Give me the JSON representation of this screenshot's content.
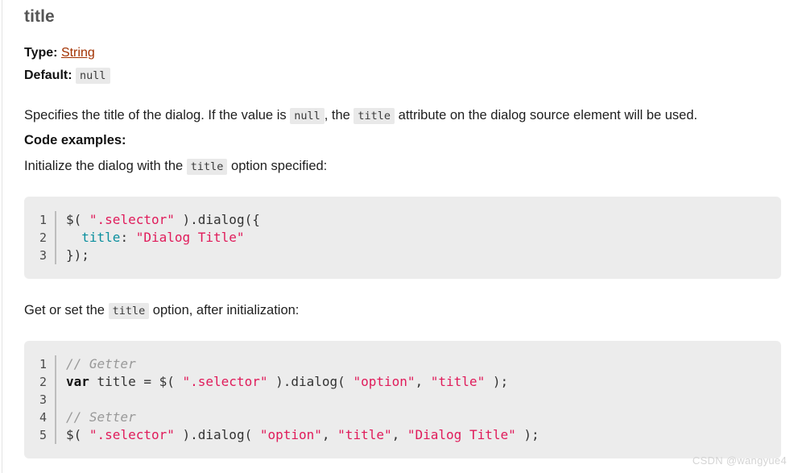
{
  "page": {
    "entry_title": "title"
  },
  "meta": {
    "type_label": "Type:",
    "type_value": "String",
    "default_label": "Default:",
    "default_value": "null"
  },
  "description": {
    "part1": "Specifies the title of the dialog. If the value is ",
    "code1": "null",
    "part2": ", the ",
    "code2": "title",
    "part3": " attribute on the dialog source element will be used."
  },
  "code_examples_heading": "Code examples:",
  "init_caption": {
    "part1": "Initialize the dialog with the ",
    "code1": "title",
    "part2": " option specified:"
  },
  "getset_caption": {
    "part1": "Get or set the ",
    "code1": "title",
    "part2": " option, after initialization:"
  },
  "code_block_1": {
    "lines": [
      {
        "no": "1",
        "tokens": [
          {
            "t": "$( ",
            "c": "pun"
          },
          {
            "t": "\".selector\"",
            "c": "str"
          },
          {
            "t": " ).dialog({",
            "c": "pun"
          }
        ]
      },
      {
        "no": "2",
        "tokens": [
          {
            "t": "  ",
            "c": "pun"
          },
          {
            "t": "title",
            "c": "key"
          },
          {
            "t": ": ",
            "c": "pun"
          },
          {
            "t": "\"Dialog Title\"",
            "c": "str"
          }
        ]
      },
      {
        "no": "3",
        "tokens": [
          {
            "t": "});",
            "c": "pun"
          }
        ]
      }
    ]
  },
  "code_block_2": {
    "lines": [
      {
        "no": "1",
        "tokens": [
          {
            "t": "// Getter",
            "c": "com"
          }
        ]
      },
      {
        "no": "2",
        "tokens": [
          {
            "t": "var",
            "c": "var"
          },
          {
            "t": " title = $( ",
            "c": "pun"
          },
          {
            "t": "\".selector\"",
            "c": "str"
          },
          {
            "t": " ).dialog( ",
            "c": "pun"
          },
          {
            "t": "\"option\"",
            "c": "str"
          },
          {
            "t": ", ",
            "c": "pun"
          },
          {
            "t": "\"title\"",
            "c": "str"
          },
          {
            "t": " );",
            "c": "pun"
          }
        ]
      },
      {
        "no": "3",
        "tokens": [
          {
            "t": "",
            "c": "pun"
          }
        ]
      },
      {
        "no": "4",
        "tokens": [
          {
            "t": "// Setter",
            "c": "com"
          }
        ]
      },
      {
        "no": "5",
        "tokens": [
          {
            "t": "$( ",
            "c": "pun"
          },
          {
            "t": "\".selector\"",
            "c": "str"
          },
          {
            "t": " ).dialog( ",
            "c": "pun"
          },
          {
            "t": "\"option\"",
            "c": "str"
          },
          {
            "t": ", ",
            "c": "pun"
          },
          {
            "t": "\"title\"",
            "c": "str"
          },
          {
            "t": ", ",
            "c": "pun"
          },
          {
            "t": "\"Dialog Title\"",
            "c": "str"
          },
          {
            "t": " );",
            "c": "pun"
          }
        ]
      }
    ]
  },
  "watermark": "CSDN @wangyue4",
  "colors": {
    "string": "#e01b5a",
    "keyword": "#0b8f9e",
    "comment": "#999999",
    "link": "#a23100",
    "code_bg": "#ececec",
    "chip_bg": "#e9e9e9"
  }
}
